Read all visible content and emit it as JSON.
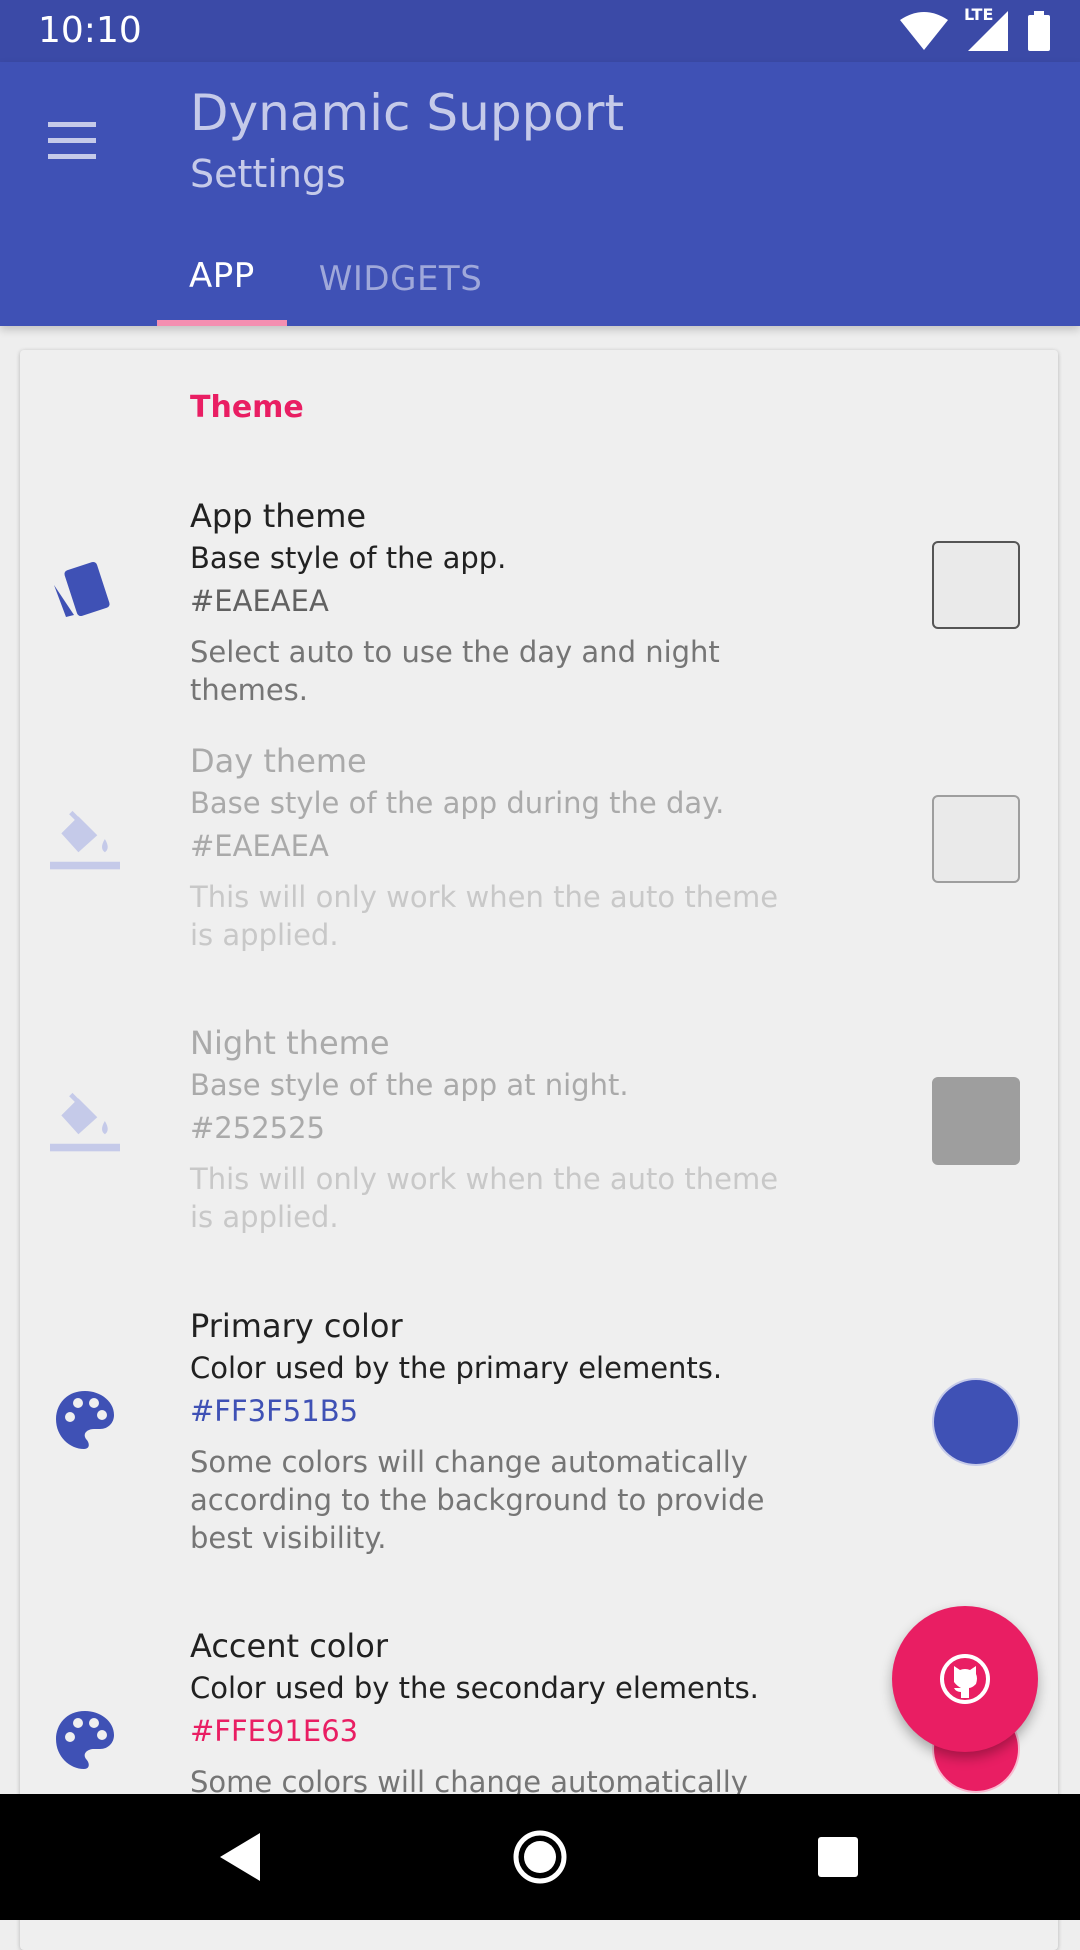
{
  "status_bar": {
    "time": "10:10",
    "network_label": "LTE"
  },
  "toolbar": {
    "title": "Dynamic Support",
    "subtitle": "Settings"
  },
  "tabs": [
    {
      "label": "APP",
      "active": true
    },
    {
      "label": "WIDGETS",
      "active": false
    }
  ],
  "section": {
    "title": "Theme"
  },
  "prefs": [
    {
      "icon": "app-theme-icon",
      "title": "App theme",
      "summary": "Base style of the app.",
      "value": "#EAEAEA",
      "description": "Select auto to use the day and night themes.",
      "color": "#EAEAEA",
      "enabled": true
    },
    {
      "icon": "paint-bucket-icon",
      "title": "Day theme",
      "summary": "Base style of the app during the day.",
      "value": "#EAEAEA",
      "description": "This will only work when the auto theme is applied.",
      "color": "#EAEAEA",
      "enabled": false
    },
    {
      "icon": "paint-bucket-icon",
      "title": "Night theme",
      "summary": "Base style of the app at night.",
      "value": "#252525",
      "description": "This will only work when the auto theme is applied.",
      "color": "#9E9E9E",
      "enabled": false
    },
    {
      "icon": "palette-icon",
      "title": "Primary color",
      "summary": "Color used by the primary elements.",
      "value": "#FF3F51B5",
      "description": "Some colors will change automatically according to the background to provide best visibility.",
      "color": "#3F51B5",
      "enabled": true
    },
    {
      "icon": "palette-icon",
      "title": "Accent color",
      "summary": "Color used by the secondary elements.",
      "value": "#FFE91E63",
      "description": "Some colors will change automatically",
      "color": "#E91E63",
      "enabled": true
    }
  ],
  "fab": {
    "icon": "github-icon"
  },
  "colors": {
    "primary": "#3F51B5",
    "primary_dark": "#3B4AA7",
    "accent": "#E91E63"
  }
}
